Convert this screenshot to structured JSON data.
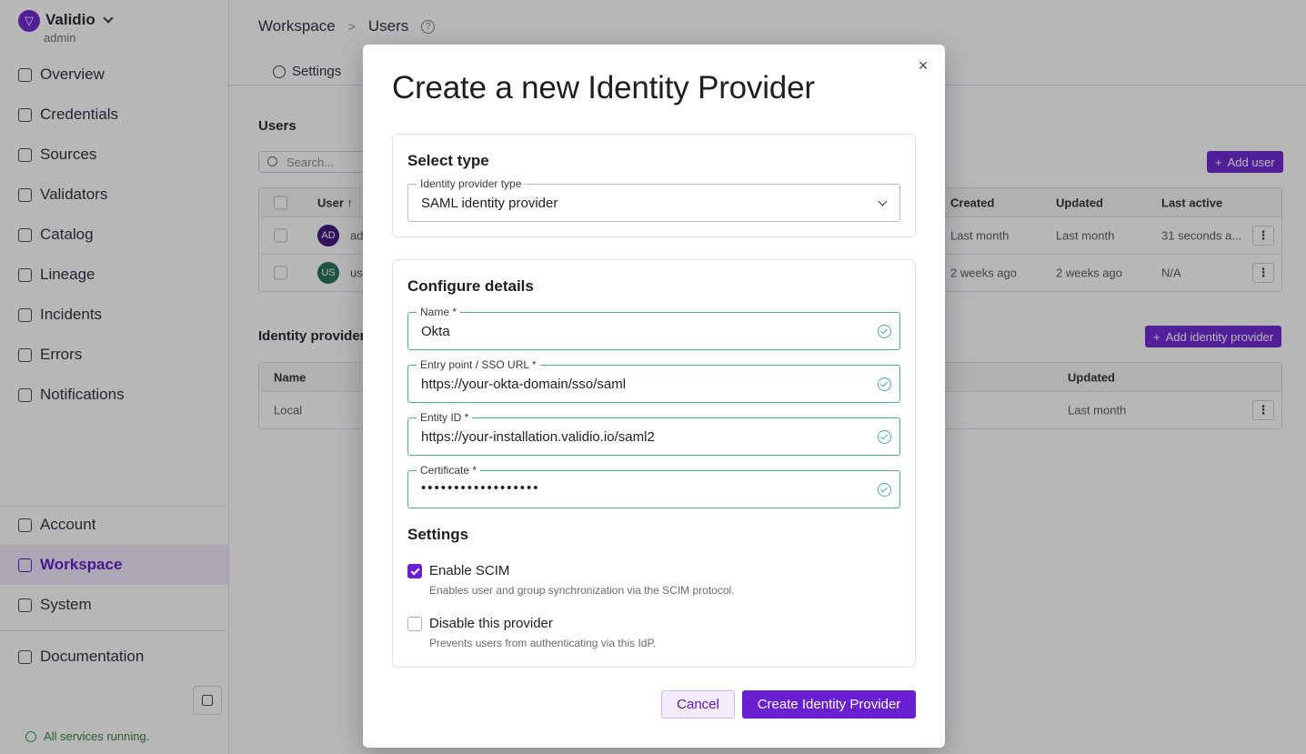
{
  "brand": {
    "name": "Validio",
    "subtitle": "admin",
    "logo_glyph": "▽"
  },
  "sidebar": {
    "items": [
      {
        "label": "Overview",
        "icon": "home-icon"
      },
      {
        "label": "Credentials",
        "icon": "key-icon"
      },
      {
        "label": "Sources",
        "icon": "sources-icon"
      },
      {
        "label": "Validators",
        "icon": "validators-icon"
      },
      {
        "label": "Catalog",
        "icon": "catalog-icon"
      },
      {
        "label": "Lineage",
        "icon": "lineage-icon"
      },
      {
        "label": "Incidents",
        "icon": "flame-icon"
      },
      {
        "label": "Errors",
        "icon": "error-icon"
      },
      {
        "label": "Notifications",
        "icon": "bell-icon"
      }
    ],
    "bottom_items": [
      {
        "label": "Account",
        "icon": "user-icon"
      },
      {
        "label": "Workspace",
        "icon": "building-icon",
        "active": true
      },
      {
        "label": "System",
        "icon": "server-icon"
      }
    ],
    "documentation": {
      "label": "Documentation",
      "icon": "book-icon"
    },
    "status_text": "All services running."
  },
  "page": {
    "breadcrumb": [
      "Workspace",
      "Users"
    ],
    "tab_settings": "Settings",
    "users_title": "Users",
    "search_placeholder": "Search...",
    "add_user_label": "Add user",
    "users_table": {
      "headers": [
        "User",
        "Created",
        "Updated",
        "Last active"
      ],
      "rows": [
        {
          "avatar": "AD",
          "avatar_color": "#3b0f7a",
          "name": "ad",
          "created": "Last month",
          "updated": "Last month",
          "last_active": "31 seconds a..."
        },
        {
          "avatar": "US",
          "avatar_color": "#1f6b52",
          "name": "us",
          "created": "2 weeks ago",
          "updated": "2 weeks ago",
          "last_active": "N/A"
        }
      ]
    },
    "idp_title": "Identity providers",
    "add_idp_label": "Add identity provider",
    "idp_table": {
      "headers": [
        "Name",
        "Updated"
      ],
      "rows": [
        {
          "name": "Local",
          "updated": "Last month"
        }
      ]
    }
  },
  "modal": {
    "title": "Create a new Identity Provider",
    "select_type": {
      "heading": "Select type",
      "field_label": "Identity provider type",
      "value": "SAML identity provider"
    },
    "configure": {
      "heading": "Configure details",
      "fields": [
        {
          "label": "Name *",
          "value": "Okta"
        },
        {
          "label": "Entry point / SSO URL *",
          "value": "https://your-okta-domain/sso/saml"
        },
        {
          "label": "Entity ID *",
          "value": "https://your-installation.validio.io/saml2"
        },
        {
          "label": "Certificate *",
          "value": "••••••••••••••••••"
        }
      ],
      "settings_heading": "Settings",
      "options": [
        {
          "label": "Enable SCIM",
          "description": "Enables user and group synchronization via the SCIM protocol.",
          "checked": true
        },
        {
          "label": "Disable this provider",
          "description": "Prevents users from authenticating via this IdP.",
          "checked": false
        }
      ]
    },
    "cancel_label": "Cancel",
    "create_label": "Create Identity Provider"
  },
  "colors": {
    "accent": "#6a1fd0",
    "valid": "#4cae97"
  }
}
